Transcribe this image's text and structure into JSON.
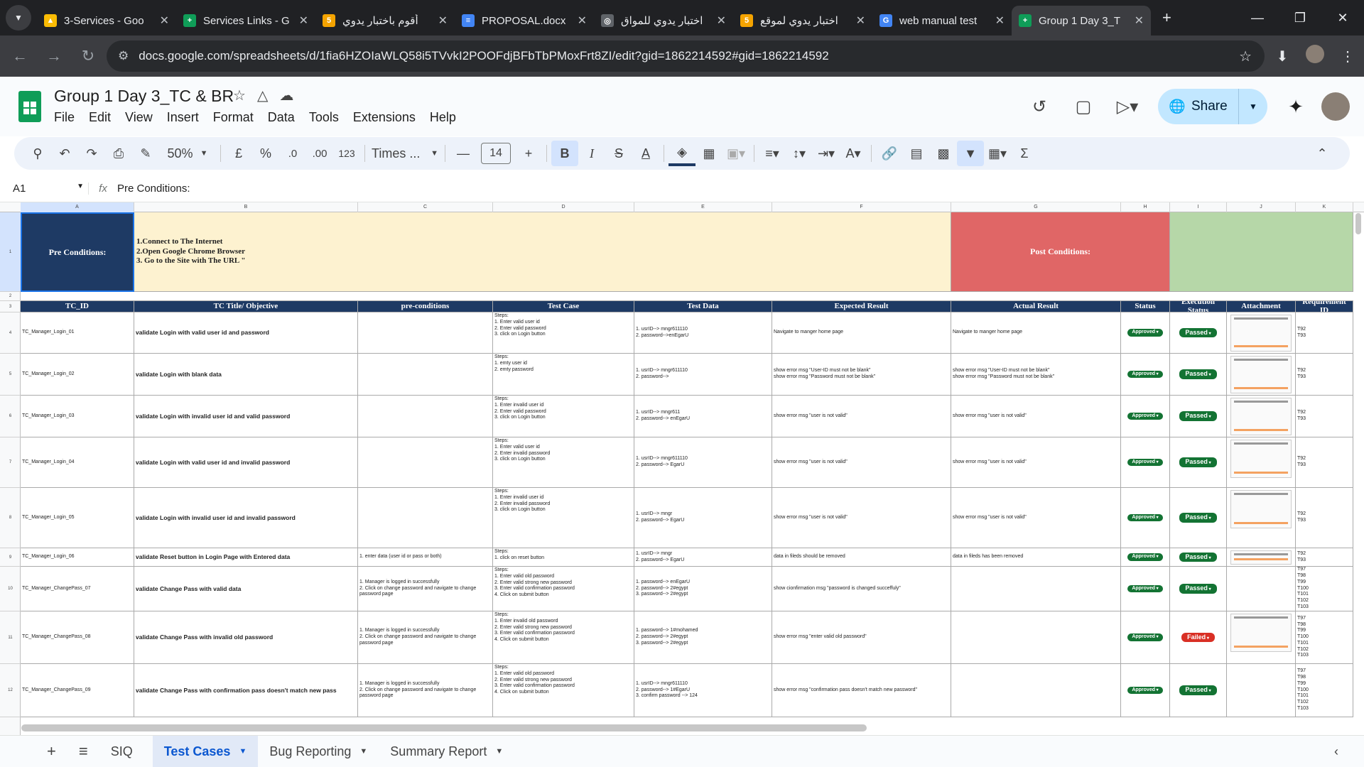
{
  "browser": {
    "tabs": [
      {
        "title": "3-Services - Goo",
        "icon_color": "#fbbc04",
        "icon": "drive-icon",
        "glyph": "▲"
      },
      {
        "title": "Services Links - G",
        "icon_color": "#0f9d58",
        "icon": "sheets-icon",
        "glyph": "+"
      },
      {
        "title": "أقوم باختبار يدوي",
        "icon_color": "#f4a300",
        "icon": "site-5-icon",
        "glyph": "5"
      },
      {
        "title": "PROPOSAL.docx",
        "icon_color": "#4285f4",
        "icon": "docs-icon",
        "glyph": "≡"
      },
      {
        "title": "اختبار يدوي للمواق",
        "icon_color": "#5f6368",
        "icon": "chatgpt-icon",
        "glyph": "◎"
      },
      {
        "title": "اختبار يدوي لموقع",
        "icon_color": "#f4a300",
        "icon": "site-5-icon",
        "glyph": "5"
      },
      {
        "title": "web manual test",
        "icon_color": "#4285f4",
        "icon": "google-icon",
        "glyph": "G"
      },
      {
        "title": "Group 1 Day 3_T",
        "icon_color": "#0f9d58",
        "icon": "sheets-icon",
        "glyph": "+"
      }
    ],
    "url": "docs.google.com/spreadsheets/d/1fia6HZOIaWLQ58i5TVvkI2POOFdjBFbTbPMoxFrt8ZI/edit?gid=1862214592#gid=1862214592"
  },
  "doc": {
    "title": "Group 1 Day 3_TC & BR",
    "menus": [
      "File",
      "Edit",
      "View",
      "Insert",
      "Format",
      "Data",
      "Tools",
      "Extensions",
      "Help"
    ],
    "share_label": "Share"
  },
  "toolbar": {
    "zoom": "50%",
    "currency": "£",
    "percent": "%",
    "dec_less": ".0",
    "dec_more": ".00",
    "number_fmt": "123",
    "font": "Times ...",
    "font_size": "14"
  },
  "formula": {
    "cell_ref": "A1",
    "content": "Pre Conditions:"
  },
  "columns": [
    "A",
    "B",
    "C",
    "D",
    "E",
    "F",
    "G",
    "H",
    "I",
    "J",
    "K"
  ],
  "rows": [
    "1",
    "2",
    "3",
    "4",
    "5",
    "6",
    "7",
    "8",
    "9",
    "10",
    "11",
    "12"
  ],
  "banner": {
    "pre_label": "Pre Conditions:",
    "pre_text": "1.Connect to The Internet\n2.Open Google Chrome Browser\n3. Go to the Site with The URL \"",
    "post_label": "Post Conditions:"
  },
  "headers": [
    "TC_ID",
    "TC Title/ Objective",
    "pre-conditions",
    "Test Case",
    "Test Data",
    "Expected Result",
    "Actual Result",
    "Status",
    "Execution Status",
    "Attachment",
    "Requirement ID"
  ],
  "test_cases": [
    {
      "id": "TC_Manager_Login_01",
      "title": "validate Login with valid user id and password",
      "pre": "",
      "steps": "Steps:\n1. Enter valid user id\n2. Enter valid password\n3. click on Login button",
      "data": "1. usrID--> mngr611110\n2.  password-->enEgarU",
      "expected": "Navigate to manger home page",
      "actual": "Navigate to manger home page",
      "status": "Approved",
      "exec": "Passed",
      "req": "T92\nT93"
    },
    {
      "id": "TC_Manager_Login_02",
      "title": "validate Login with blank data",
      "pre": "",
      "steps": "Steps:\n1. emty user id\n2. emty password",
      "data": "1. usrID--> mngr611110\n2.  password-->",
      "expected": "show error msg \"User-ID must not be blank\"\nshow error msg \"Password must not be blank\"",
      "actual": "show error msg \"User-ID must not be blank\"\nshow error msg \"Password must not be blank\"",
      "status": "Approved",
      "exec": "Passed",
      "req": "T92\nT93"
    },
    {
      "id": "TC_Manager_Login_03",
      "title": "validate Login with invalid user id and valid password",
      "pre": "",
      "steps": "Steps:\n1. Enter invalid user id\n2. Enter valid password\n3. click on Login button",
      "data": "1.  usrID--> mngr611\n2.  password--> enEgarU",
      "expected": "show error msg \"user is not valid\"",
      "actual": "show error msg \"user is not valid\"",
      "status": "Approved",
      "exec": "Passed",
      "req": "T92\nT93"
    },
    {
      "id": "TC_Manager_Login_04",
      "title": "validate Login with valid user id and invalid password",
      "pre": "",
      "steps": "Steps:\n1. Enter valid user id\n2. Enter invalid password\n3. click on Login button",
      "data": "1.  usrID--> mngr611110\n2.  password--> EgarU",
      "expected": "show error msg \"user is not valid\"",
      "actual": "show error msg \"user is not valid\"",
      "status": "Approved",
      "exec": "Passed",
      "req": "T92\nT93"
    },
    {
      "id": "TC_Manager_Login_05",
      "title": "validate Login with invalid user id and invalid password",
      "pre": "",
      "steps": "Steps:\n1. Enter invalid user id\n2. Enter invalid password\n3. click on Login button",
      "data": "1.  usrID--> mngr\n2.  password--> EgarU",
      "expected": "show error msg \"user is not valid\"",
      "actual": "show error msg \"user is not valid\"",
      "status": "Approved",
      "exec": "Passed",
      "req": "T92\nT93"
    },
    {
      "id": "TC_Manager_Login_06",
      "title": "validate Reset button in Login Page with Entered data",
      "pre": "1. enter data (user id or pass or both)",
      "steps": "Steps:\n1. click on reset button",
      "data": "1.  usrID--> mngr\n2.  password--> EgarU",
      "expected": "data in fileds should be removed",
      "actual": "data in fileds has been removed",
      "status": "Approved",
      "exec": "Passed",
      "req": "T92\nT93"
    },
    {
      "id": "TC_Manager_ChangePass_07",
      "title": "validate Change Pass with valid data",
      "pre": "1. Manager is logged in successfully\n2. Click on change password and navigate to change password page",
      "steps": "Steps:\n1. Enter valid old password\n2. Enter valid strong new password\n3. Enter valid confirmation password\n4. Click on submit button",
      "data": "1.  password--> enEgarU\n2. password--> 2#egypt\n3. password--> 2#egypt",
      "expected": "show cionfirmation msg \"password is changed succeffuly\"",
      "actual": "",
      "status": "Approved",
      "exec": "Passed",
      "req": "T97\nT98\nT99\nT100\nT101\nT102\nT103"
    },
    {
      "id": "TC_Manager_ChangePass_08",
      "title": "validate Change Pass with invalid old password",
      "pre": "1. Manager is logged in successfully\n2. Click on change password and navigate to change password page",
      "steps": "Steps:\n1. Enter invalid old password\n2. Enter valid strong new password\n3. Enter valid confirmation password\n4. Click on submit button",
      "data": "1.  password--> 1#mohamed\n2. password--> 2#egypt\n3. password--> 2#egypt",
      "expected": "show error msg \"enter valid old password\"",
      "actual": "",
      "status": "Approved",
      "exec": "Failed",
      "req": "T97\nT98\nT99\nT100\nT101\nT102\nT103"
    },
    {
      "id": "TC_Manager_ChangePass_09",
      "title": "validate Change Pass with confirmation pass doesn't match new pass",
      "pre": "1. Manager is logged in successfully\n2. Click on change password and navigate to change password page",
      "steps": "Steps:\n1. Enter valid old password\n2. Enter valid strong new password\n3. Enter valid confirmation password\n4. Click on submit button",
      "data": "1.  usrID--> mngr611110\n2.  password--> 1#EgarU\n3.  confirm password --> 124",
      "expected": "show error msg \"confirmation pass doesn't match new password\"",
      "actual": "",
      "status": "Approved",
      "exec": "Passed",
      "req": "T97\nT98\nT99\nT100\nT101\nT102\nT103"
    }
  ],
  "sheet_tabs": [
    "SIQ",
    "Test Cases",
    "Bug Reporting",
    "Summary Report"
  ],
  "colors": {
    "header_navy": "#1e3a64",
    "pre_bg": "#fdf2d0",
    "post_red": "#e06666",
    "post_green": "#b6d7a8",
    "approved": "#137333",
    "failed": "#d93025"
  }
}
